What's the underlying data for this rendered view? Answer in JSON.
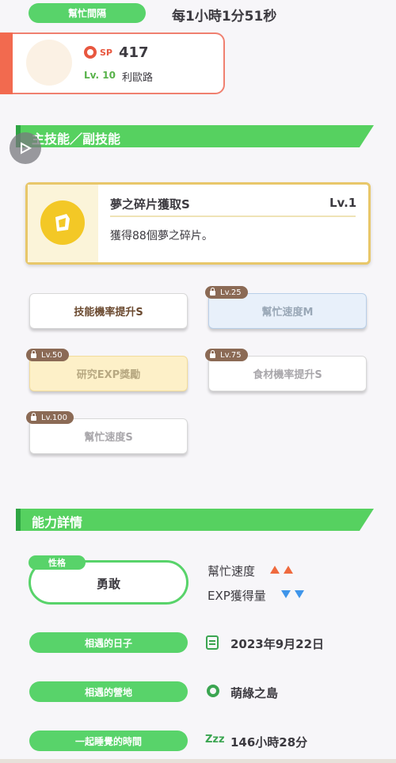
{
  "header": {
    "help_interval_label": "幫忙間隔",
    "help_interval_value": "每1小時1分51秒"
  },
  "pokemon": {
    "sp_label": "SP",
    "sp_value": "417",
    "level": "Lv. 10",
    "name": "利歐路"
  },
  "skills_section": {
    "title": "主技能／副技能",
    "main_skill": {
      "name": "夢之碎片獲取S",
      "level": "Lv.1",
      "description": "獲得88個夢之碎片。"
    },
    "sub_skills": [
      {
        "label": "技能機率提升S",
        "unlock_level": ""
      },
      {
        "label": "幫忙速度M",
        "unlock_level": "Lv.25"
      },
      {
        "label": "研究EXP獎勵",
        "unlock_level": "Lv.50"
      },
      {
        "label": "食材機率提升S",
        "unlock_level": "Lv.75"
      },
      {
        "label": "幫忙速度S",
        "unlock_level": "Lv.100"
      }
    ]
  },
  "ability_section": {
    "title": "能力詳情",
    "nature_label": "性格",
    "nature_name": "勇敢",
    "stat_up": "幫忙速度",
    "stat_down": "EXP獲得量",
    "met_day_label": "相遇的日子",
    "met_day_value": "2023年9月22日",
    "met_place_label": "相遇的營地",
    "met_place_value": "萌綠之島",
    "sleep_label": "一起睡覺的時間",
    "sleep_value": "146小時28分",
    "sleep_icon_text": "Zzz"
  },
  "colors": {
    "accent_green": "#58d36a",
    "card_red": "#f26a4f",
    "gold": "#e8c76a",
    "up_orange": "#ef6a3e",
    "down_blue": "#3f95ea"
  },
  "icons": {
    "sp": "pokeball-sp-icon",
    "main_skill": "dream-shard-icon",
    "play": "play-icon",
    "lock": "lock-icon",
    "calendar": "calendar-icon",
    "location": "location-pin-icon",
    "sleep": "sleep-zzz-icon"
  }
}
